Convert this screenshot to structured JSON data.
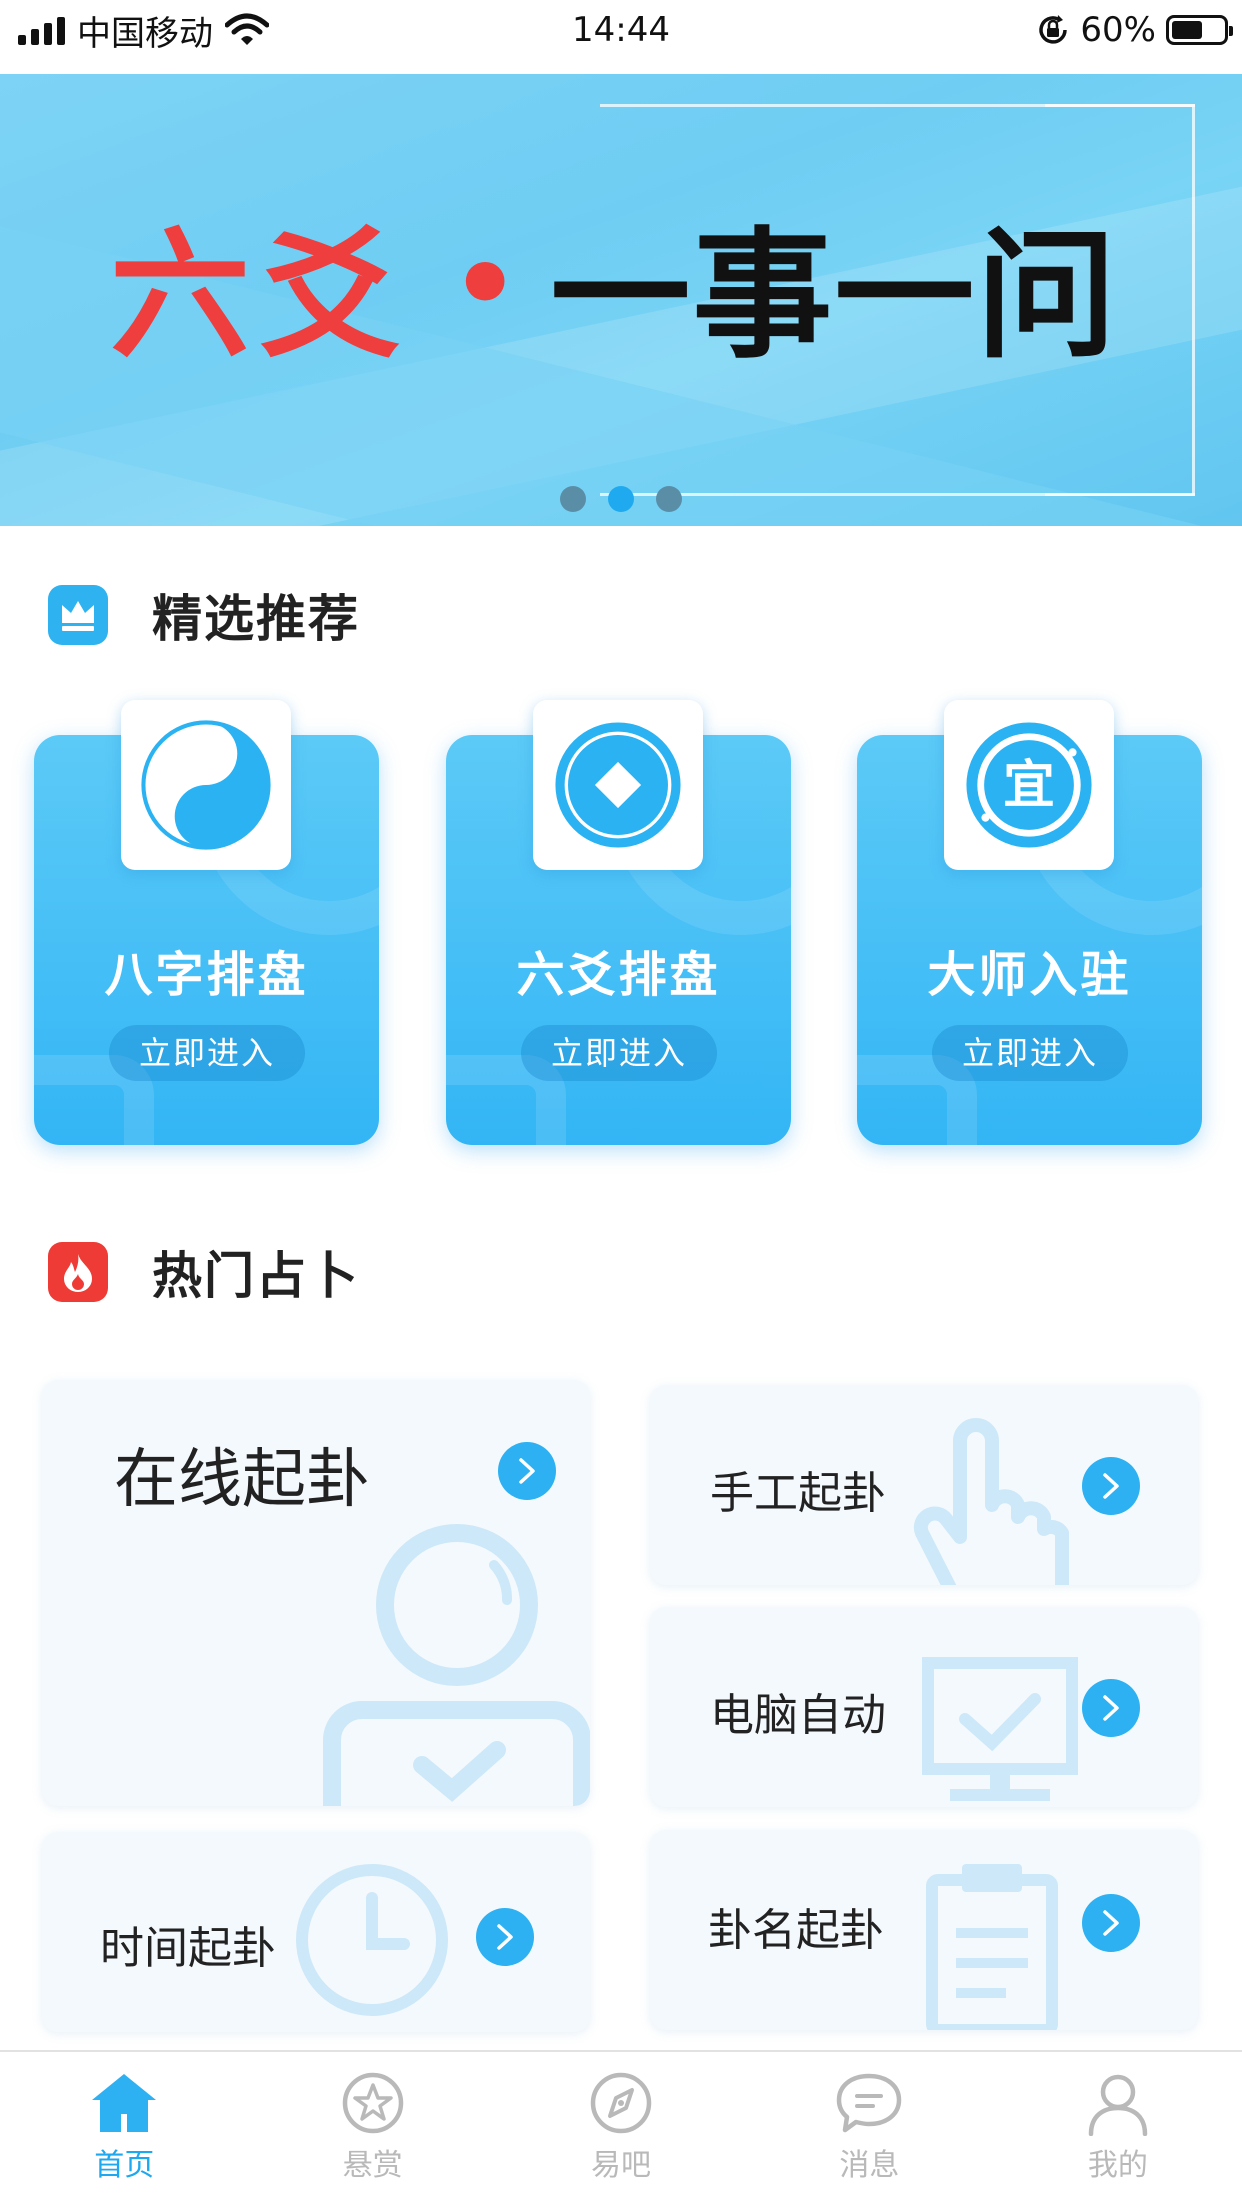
{
  "status_bar": {
    "carrier": "中国移动",
    "time": "14:44",
    "battery_percent": "60%",
    "battery_level": 0.6
  },
  "banner": {
    "title_red": "六爻",
    "title_dot": "•",
    "title_black": "一事一问",
    "slide_count": 3,
    "active_slide": 1
  },
  "featured": {
    "title": "精选推荐",
    "cards": [
      {
        "label": "八字排盘",
        "button": "立即进入",
        "icon": "yin-yang-icon"
      },
      {
        "label": "六爻排盘",
        "button": "立即进入",
        "icon": "coin-icon"
      },
      {
        "label": "大师入驻",
        "button": "立即进入",
        "icon": "seal-icon",
        "icon_text": "宜"
      }
    ]
  },
  "hot": {
    "title": "热门占卜",
    "items": [
      {
        "label": "在线起卦",
        "icon": "person-check-icon"
      },
      {
        "label": "手工起卦",
        "icon": "hand-pointer-icon"
      },
      {
        "label": "电脑自动",
        "icon": "monitor-check-icon"
      },
      {
        "label": "时间起卦",
        "icon": "clock-icon"
      },
      {
        "label": "卦名起卦",
        "icon": "clipboard-icon"
      }
    ]
  },
  "tab_bar": {
    "tabs": [
      {
        "label": "首页",
        "icon": "home-icon",
        "active": true
      },
      {
        "label": "悬赏",
        "icon": "star-badge-icon",
        "active": false
      },
      {
        "label": "易吧",
        "icon": "compass-icon",
        "active": false
      },
      {
        "label": "消息",
        "icon": "chat-icon",
        "active": false
      },
      {
        "label": "我的",
        "icon": "user-icon",
        "active": false
      }
    ]
  },
  "colors": {
    "accent": "#1ea8f0",
    "banner_red": "#ee3e3e",
    "card_blue": "#33b5f5",
    "hot_red": "#ef3b36"
  }
}
